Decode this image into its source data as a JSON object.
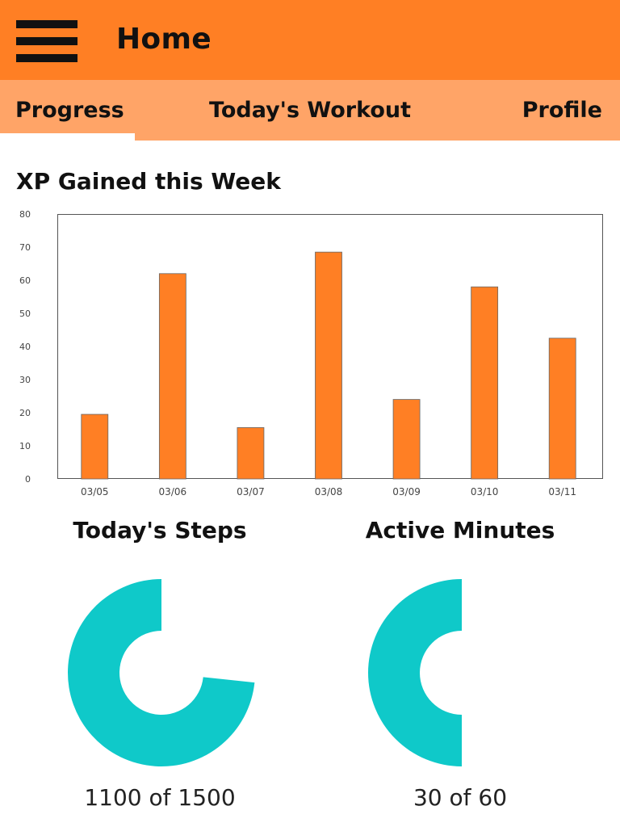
{
  "header": {
    "title": "Home",
    "menu_icon": "hamburger-menu-icon",
    "background": "#ff7f24"
  },
  "tabs": [
    {
      "label": "Progress",
      "active": true
    },
    {
      "label": "Today's Workout",
      "active": false
    },
    {
      "label": "Profile",
      "active": false
    }
  ],
  "tab_background": "#ffa467",
  "xp_chart": {
    "title": "XP Gained this Week"
  },
  "chart_data": {
    "type": "bar",
    "title": "XP Gained this Week",
    "categories": [
      "03/05",
      "03/06",
      "03/07",
      "03/08",
      "03/09",
      "03/10",
      "03/11"
    ],
    "values": [
      19.5,
      62,
      15.5,
      68.5,
      24,
      58,
      42.5
    ],
    "ylim": [
      0,
      80
    ],
    "yticks": [
      0,
      10,
      20,
      30,
      40,
      50,
      60,
      70,
      80
    ],
    "bar_color": "#ff7f24",
    "grid": false,
    "legend": "none"
  },
  "steps": {
    "title": "Today's Steps",
    "current": 1100,
    "goal": 1500,
    "label": "1100 of 1500",
    "color": "#0fc9c9"
  },
  "active_minutes": {
    "title": "Active Minutes",
    "current": 30,
    "goal": 60,
    "label": "30 of 60",
    "color": "#0fc9c9"
  }
}
